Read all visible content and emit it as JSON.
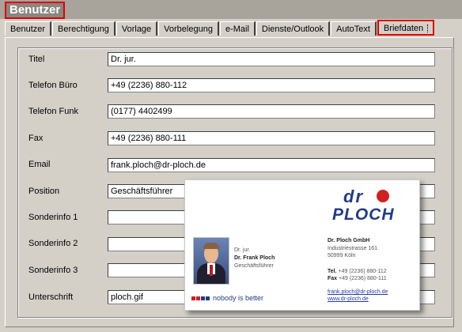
{
  "header": {
    "title": "Benutzer"
  },
  "tabs": [
    {
      "label": "Benutzer"
    },
    {
      "label": "Berechtigung"
    },
    {
      "label": "Vorlage"
    },
    {
      "label": "Vorbelegung"
    },
    {
      "label": "e-Mail"
    },
    {
      "label": "Dienste/Outlook"
    },
    {
      "label": "AutoText"
    },
    {
      "label": "Briefdaten",
      "active": true
    }
  ],
  "fields": [
    {
      "label": "Titel",
      "value": "Dr. jur."
    },
    {
      "label": "Telefon Büro",
      "value": "+49 (2236) 880-112"
    },
    {
      "label": "Telefon Funk",
      "value": "(0177) 4402499"
    },
    {
      "label": "Fax",
      "value": "+49 (2236) 880-111"
    },
    {
      "label": "Email",
      "value": "frank.ploch@dr-ploch.de"
    },
    {
      "label": "Position",
      "value": "Geschäftsführer"
    },
    {
      "label": "Sonderinfo 1",
      "value": ""
    },
    {
      "label": "Sonderinfo 2",
      "value": ""
    },
    {
      "label": "Sonderinfo 3",
      "value": ""
    },
    {
      "label": "Unterschrift",
      "value": "ploch.gif"
    }
  ],
  "card": {
    "logo_top": "dr",
    "logo_bottom": "PLOCH",
    "title": "Dr. jur.",
    "name": "Dr. Frank Ploch",
    "position": "Geschäftsführer",
    "company": "Dr. Ploch GmbH",
    "street": "Industriestrasse 161",
    "city": "50999 Köln",
    "tel_label": "Tel.",
    "tel": "+49 (2236) 880-112",
    "fax_label": "Fax",
    "fax": "+49 (2236) 880-111",
    "email": "frank.ploch@dr-ploch.de",
    "web": "www.dr-ploch.de",
    "slogan": "nobody is better"
  },
  "colors": {
    "highlight": "#e00000",
    "brand_blue": "#233a86",
    "brand_red": "#d02020"
  }
}
